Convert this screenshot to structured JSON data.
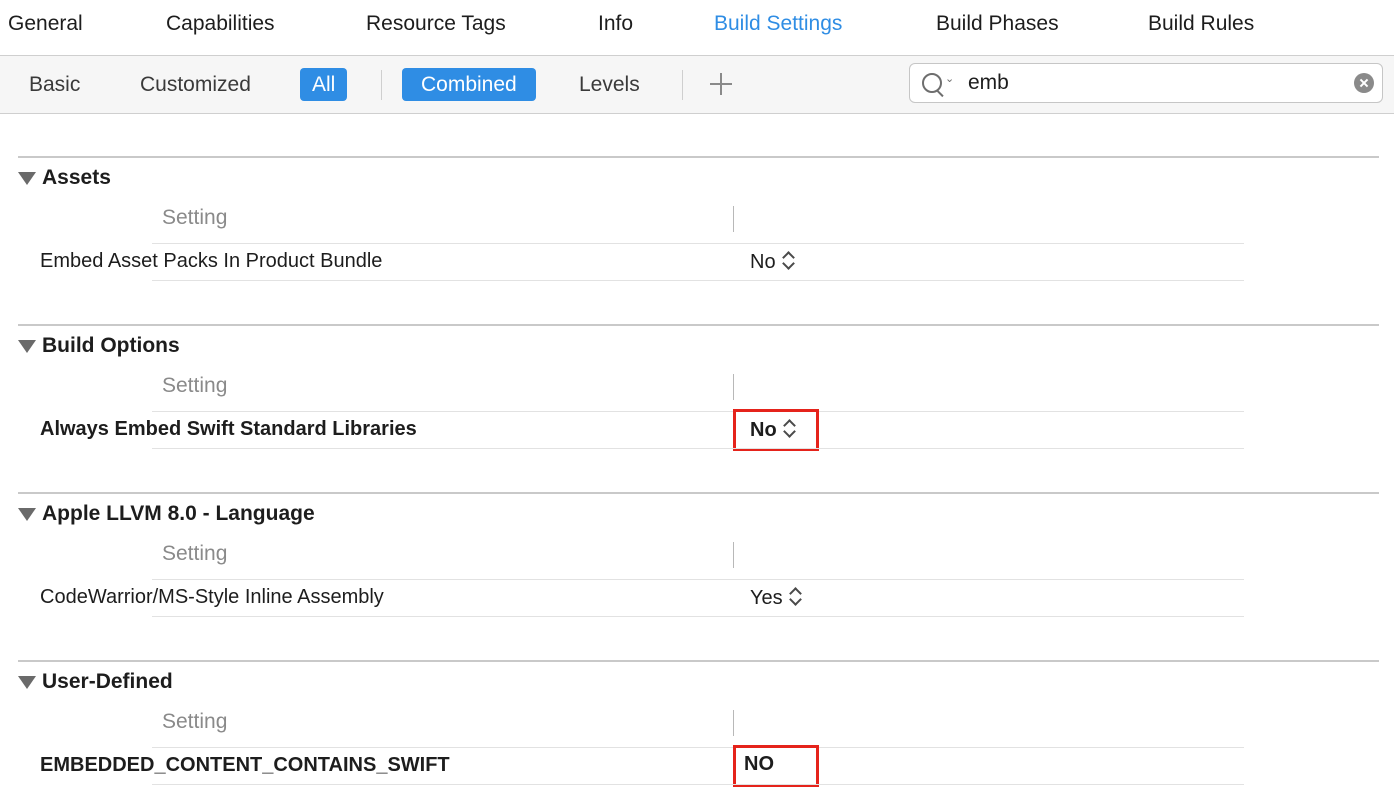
{
  "tabs": [
    "General",
    "Capabilities",
    "Resource Tags",
    "Info",
    "Build Settings",
    "Build Phases",
    "Build Rules"
  ],
  "active_tab": "Build Settings",
  "filters": {
    "basic": "Basic",
    "customized": "Customized",
    "all": "All",
    "combined": "Combined",
    "levels": "Levels"
  },
  "search": {
    "value": "emb"
  },
  "sections": [
    {
      "title": "Assets",
      "column_header": "Setting",
      "setting": {
        "name": "Embed Asset Packs In Product Bundle",
        "value": "No"
      }
    },
    {
      "title": "Build Options",
      "column_header": "Setting",
      "setting": {
        "name": "Always Embed Swift Standard Libraries",
        "value": "No"
      }
    },
    {
      "title": "Apple LLVM 8.0 - Language",
      "column_header": "Setting",
      "setting": {
        "name": "CodeWarrior/MS-Style Inline Assembly",
        "value": "Yes"
      }
    },
    {
      "title": "User-Defined",
      "column_header": "Setting",
      "setting": {
        "name": "EMBEDDED_CONTENT_CONTAINS_SWIFT",
        "value": "NO"
      }
    }
  ],
  "colors": {
    "accent": "#2f8de4",
    "highlight": "#e5231b"
  }
}
